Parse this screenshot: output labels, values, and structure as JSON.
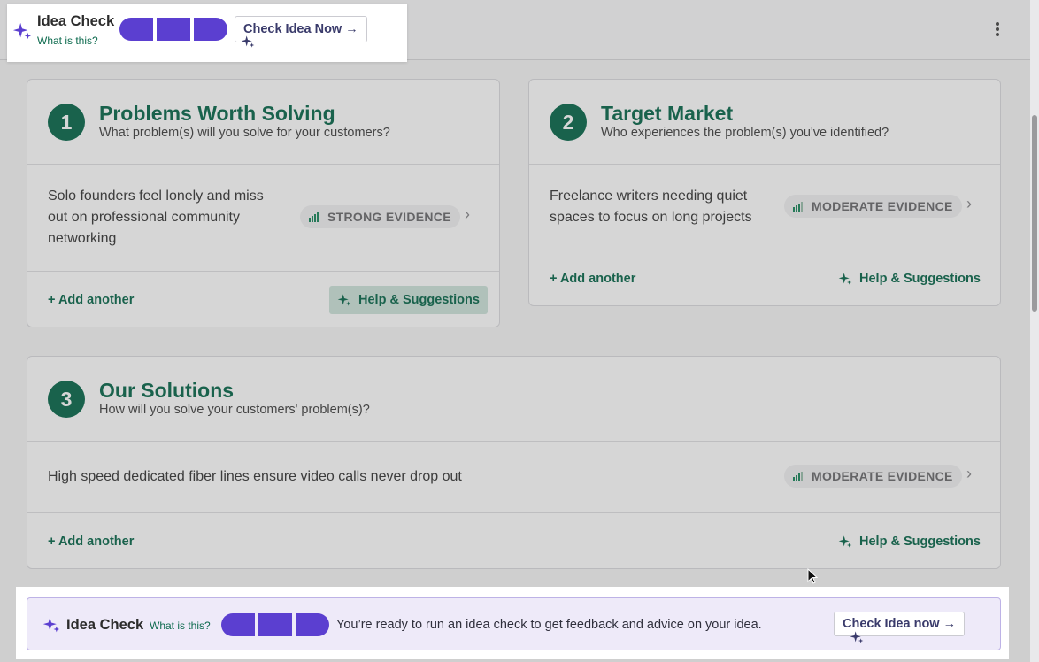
{
  "idea_check_top": {
    "title": "Idea Check",
    "what_is_this": "What is this?",
    "button_label": "Check Idea Now →",
    "pill_color": "#5b3fd0"
  },
  "cards": [
    {
      "number": "1",
      "title": "Problems Worth Solving",
      "subtitle": "What problem(s) will you solve for your customers?",
      "item_text": "Solo founders feel lonely and miss out on professional community networking",
      "evidence": "STRONG EVIDENCE",
      "add_label": "+ Add another",
      "help_label": "Help & Suggestions"
    },
    {
      "number": "2",
      "title": "Target Market",
      "subtitle": "Who experiences the problem(s) you've identified?",
      "item_text": "Freelance writers needing quiet spaces to focus on long projects",
      "evidence": "MODERATE EVIDENCE",
      "add_label": "+ Add another",
      "help_label": "Help & Suggestions"
    },
    {
      "number": "3",
      "title": "Our Solutions",
      "subtitle": "How will you solve your customers' problem(s)?",
      "item_text": "High speed dedicated fiber lines ensure video calls never drop out",
      "evidence": "MODERATE EVIDENCE",
      "add_label": "+ Add another",
      "help_label": "Help & Suggestions"
    }
  ],
  "idea_check_bottom": {
    "title": "Idea Check",
    "what_is_this": "What is this?",
    "message": "You’re ready to run an idea check to get feedback and advice on your idea.",
    "button_label": "Check Idea now →"
  },
  "colors": {
    "brand_green": "#0e6b4f",
    "accent_purple": "#5b3fd0",
    "evidence_green": "#1e8a5f"
  },
  "icons": [
    "sparkle-icon",
    "signal-bars-icon",
    "chevron-right-icon",
    "kebab-menu-icon"
  ]
}
